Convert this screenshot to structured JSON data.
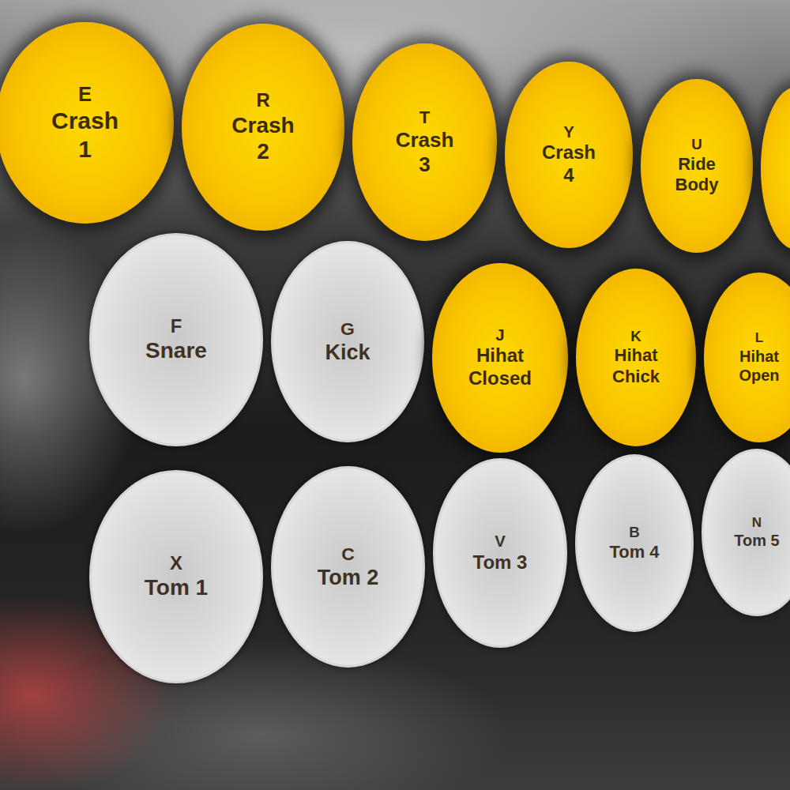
{
  "rows": [
    {
      "pads": [
        {
          "key": "E",
          "label": [
            "Crash",
            "1"
          ],
          "kind": "cymbal"
        },
        {
          "key": "R",
          "label": [
            "Crash",
            "2"
          ],
          "kind": "cymbal"
        },
        {
          "key": "T",
          "label": [
            "Crash",
            "3"
          ],
          "kind": "cymbal"
        },
        {
          "key": "Y",
          "label": [
            "Crash",
            "4"
          ],
          "kind": "cymbal"
        },
        {
          "key": "U",
          "label": [
            "Ride",
            "Body"
          ],
          "kind": "cymbal"
        },
        {
          "key": "",
          "label": [],
          "kind": "cymbal"
        }
      ]
    },
    {
      "pads": [
        {
          "key": "F",
          "label": [
            "Snare"
          ],
          "kind": "drum"
        },
        {
          "key": "G",
          "label": [
            "Kick"
          ],
          "kind": "drum"
        },
        {
          "key": "J",
          "label": [
            "Hihat",
            "Closed"
          ],
          "kind": "cymbal"
        },
        {
          "key": "K",
          "label": [
            "Hihat",
            "Chick"
          ],
          "kind": "cymbal"
        },
        {
          "key": "L",
          "label": [
            "Hihat",
            "Open"
          ],
          "kind": "cymbal"
        }
      ]
    },
    {
      "pads": [
        {
          "key": "X",
          "label": [
            "Tom 1"
          ],
          "kind": "drum"
        },
        {
          "key": "C",
          "label": [
            "Tom 2"
          ],
          "kind": "drum"
        },
        {
          "key": "V",
          "label": [
            "Tom 3"
          ],
          "kind": "drum"
        },
        {
          "key": "B",
          "label": [
            "Tom 4"
          ],
          "kind": "drum"
        },
        {
          "key": "N",
          "label": [
            "Tom 5"
          ],
          "kind": "drum"
        }
      ]
    }
  ]
}
